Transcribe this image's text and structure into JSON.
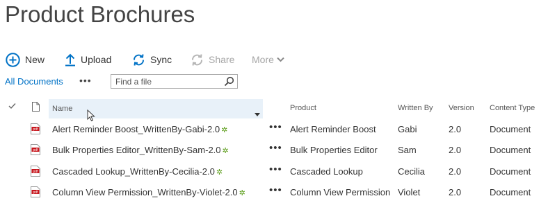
{
  "page": {
    "title": "Product Brochures"
  },
  "commands": {
    "new": "New",
    "upload": "Upload",
    "sync": "Sync",
    "share": "Share",
    "more": "More"
  },
  "views": {
    "all_documents": "All Documents",
    "more": "•••"
  },
  "search": {
    "placeholder": "Find a file"
  },
  "columns": {
    "name": "Name",
    "product": "Product",
    "written_by": "Written By",
    "version": "Version",
    "content_type": "Content Type"
  },
  "rows": [
    {
      "name": "Alert Reminder Boost_WrittenBy-Gabi-2.0",
      "new_marker": "✲",
      "actions": "•••",
      "product": "Alert Reminder Boost",
      "written_by": "Gabi",
      "version": "2.0",
      "content_type": "Document"
    },
    {
      "name": "Bulk Properties Editor_WrittenBy-Sam-2.0",
      "new_marker": "✲",
      "actions": "•••",
      "product": "Bulk Properties Editor",
      "written_by": "Sam",
      "version": "2.0",
      "content_type": "Document"
    },
    {
      "name": "Cascaded Lookup_WrittenBy-Cecilia-2.0",
      "new_marker": "✲",
      "actions": "•••",
      "product": "Cascaded Lookup",
      "written_by": "Cecilia",
      "version": "2.0",
      "content_type": "Document"
    },
    {
      "name": "Column View Permission_WrittenBy-Violet-2.0",
      "new_marker": "✲",
      "actions": "•••",
      "product": "Column View Permission",
      "written_by": "Violet",
      "version": "2.0",
      "content_type": "Document"
    }
  ],
  "icons": {
    "new": "plus-circle-icon",
    "upload": "upload-arrow-icon",
    "sync": "sync-icon",
    "share": "share-icon",
    "more": "chevron-down-icon",
    "search": "magnifier-icon",
    "file_type": "pdf-icon"
  },
  "colors": {
    "accent": "#0072c6",
    "new_marker": "#5d9e1c",
    "header_highlight": "#e8f1f9"
  }
}
